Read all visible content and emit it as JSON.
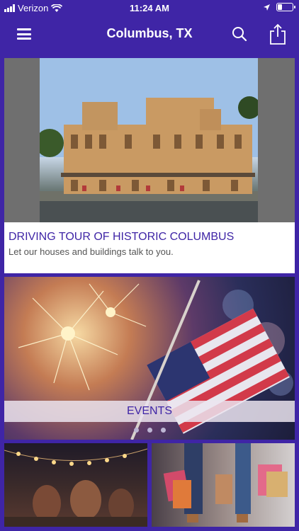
{
  "status": {
    "carrier": "Verizon",
    "time": "11:24 AM"
  },
  "navbar": {
    "title": "Columbus, TX",
    "menu_icon": "hamburger-icon",
    "search_icon": "search-icon",
    "share_icon": "share-icon"
  },
  "tour_card": {
    "title": "DRIVING TOUR OF HISTORIC COLUMBUS",
    "subtitle": "Let our houses and buildings talk to you."
  },
  "events_card": {
    "label": "EVENTS",
    "pages": 3
  },
  "colors": {
    "brand": "#3f25a6"
  }
}
